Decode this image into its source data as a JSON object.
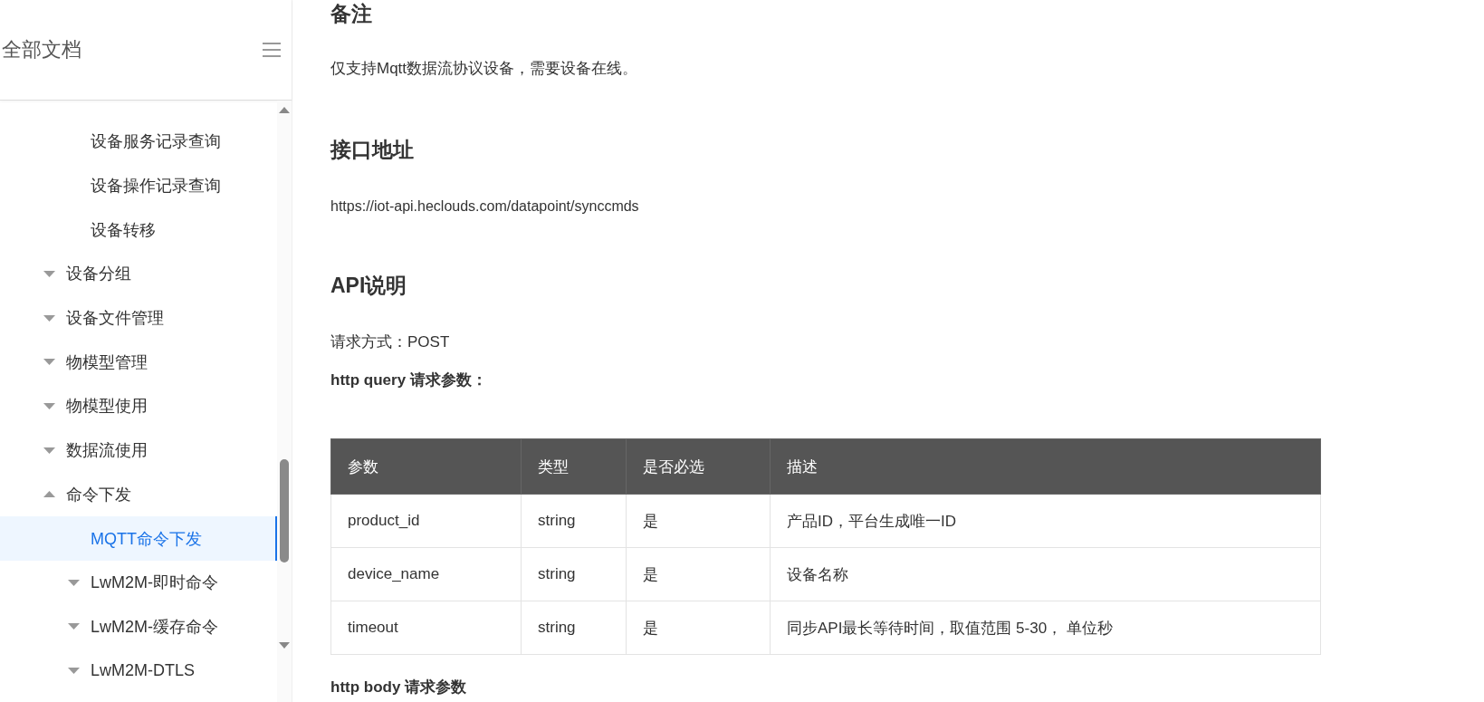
{
  "sidebar": {
    "title": "全部文档",
    "items": [
      {
        "kind": "group",
        "children": [
          {
            "kind": "page",
            "label": "设备服务记录查询",
            "selected": false
          },
          {
            "kind": "page",
            "label": "设备操作记录查询",
            "selected": false
          },
          {
            "kind": "page",
            "label": "设备转移",
            "selected": false
          }
        ]
      },
      {
        "kind": "folder",
        "label": "设备分组",
        "expanded": false,
        "selected": false
      },
      {
        "kind": "folder",
        "label": "设备文件管理",
        "expanded": false,
        "selected": false
      },
      {
        "kind": "folder",
        "label": "物模型管理",
        "expanded": false,
        "selected": false
      },
      {
        "kind": "folder",
        "label": "物模型使用",
        "expanded": false,
        "selected": false
      },
      {
        "kind": "folder",
        "label": "数据流使用",
        "expanded": false,
        "selected": false
      },
      {
        "kind": "folder",
        "label": "命令下发",
        "expanded": true,
        "selected": false,
        "children": [
          {
            "kind": "page",
            "label": "MQTT命令下发",
            "selected": true
          },
          {
            "kind": "folder",
            "label": "LwM2M-即时命令",
            "expanded": false,
            "selected": false
          },
          {
            "kind": "folder",
            "label": "LwM2M-缓存命令",
            "expanded": false,
            "selected": false
          },
          {
            "kind": "folder",
            "label": "LwM2M-DTLS",
            "expanded": false,
            "selected": false
          }
        ]
      }
    ]
  },
  "content": {
    "note_heading": "备注",
    "note": "仅支持Mqtt数据流协议设备，需要设备在线。",
    "address_heading": "接口地址",
    "address": "https://iot-api.heclouds.com/datapoint/synccmds",
    "api_heading": "API说明",
    "method": "请求方式：POST",
    "query_label": "http query 请求参数：",
    "table": {
      "columns": [
        "参数",
        "类型",
        "是否必选",
        "描述"
      ],
      "rows": [
        [
          "product_id",
          "string",
          "是",
          "产品ID，平台生成唯一ID"
        ],
        [
          "device_name",
          "string",
          "是",
          "设备名称"
        ],
        [
          "timeout",
          "string",
          "是",
          "同步API最长等待时间，取值范围 5-30， 单位秒"
        ]
      ]
    },
    "body_label": "http body 请求参数"
  }
}
